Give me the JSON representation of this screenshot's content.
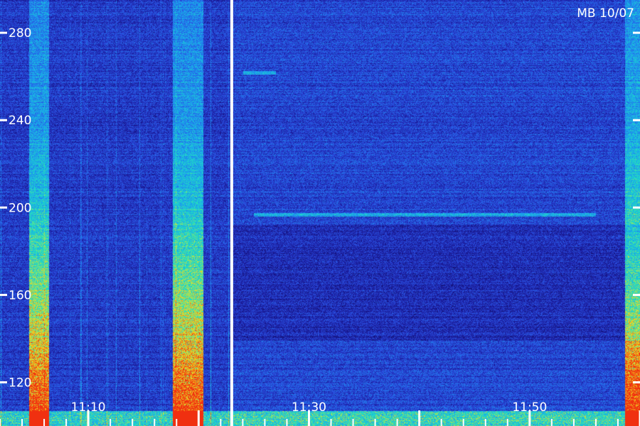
{
  "chart_data": {
    "type": "heatmap",
    "title": "MB 10/07",
    "xlabel": "",
    "ylabel": "",
    "colormap": [
      "#0a0840",
      "#1a1a9a",
      "#2a4ee0",
      "#1aa0f0",
      "#20e0c0",
      "#f0e020",
      "#f03010"
    ],
    "y_ticks": [
      {
        "value": 120,
        "label": "120"
      },
      {
        "value": 160,
        "label": "160"
      },
      {
        "value": 200,
        "label": "200"
      },
      {
        "value": 240,
        "label": "240"
      },
      {
        "value": 280,
        "label": "280"
      }
    ],
    "x_ticks": [
      {
        "value": "11:10",
        "label": "11:10"
      },
      {
        "value": "11:30",
        "label": "11:30"
      },
      {
        "value": "11:50",
        "label": "11:50"
      }
    ],
    "ylim": [
      100,
      295
    ],
    "xlim": [
      "11:02",
      "12:00"
    ],
    "gap_marker_time": "11:23",
    "features": [
      {
        "kind": "broadband_burst",
        "time_range": [
          "11:05",
          "11:06"
        ]
      },
      {
        "kind": "broadband_burst",
        "time_range": [
          "11:18",
          "11:20"
        ]
      },
      {
        "kind": "broadband_burst",
        "time_range": [
          "11:59",
          "12:00"
        ]
      },
      {
        "kind": "narrowband_line",
        "freq": 262,
        "time_range": [
          "11:24",
          "11:27"
        ]
      },
      {
        "kind": "narrowband_line",
        "freq": 197,
        "time_range": [
          "11:25",
          "11:56"
        ]
      }
    ]
  }
}
